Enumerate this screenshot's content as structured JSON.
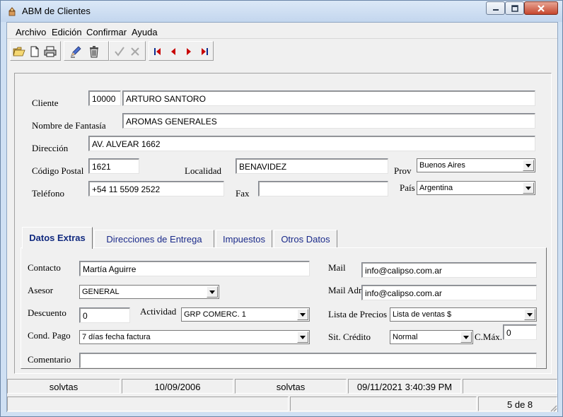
{
  "window": {
    "title": "ABM de Clientes"
  },
  "menu": {
    "items": [
      "Archivo",
      "Edición",
      "Confirmar",
      "Ayuda"
    ]
  },
  "toolbar": {
    "icons": [
      "open-folder-icon",
      "new-document-icon",
      "print-icon",
      "edit-pencil-icon",
      "delete-trash-icon",
      "confirm-check-icon",
      "cancel-x-icon",
      "first-record-icon",
      "previous-record-icon",
      "next-record-icon",
      "last-record-icon"
    ]
  },
  "form": {
    "cliente_label": "Cliente",
    "cliente_code": "10000",
    "cliente_name": "ARTURO SANTORO",
    "fantasia_label": "Nombre de Fantasía",
    "fantasia_value": "AROMAS GENERALES",
    "direccion_label": "Dirección",
    "direccion_value": "AV. ALVEAR 1662",
    "cp_label": "Código Postal",
    "cp_value": "1621",
    "localidad_label": "Localidad",
    "localidad_value": "BENAVIDEZ",
    "prov_label": "Prov",
    "prov_value": "Buenos Aires",
    "telefono_label": "Teléfono",
    "telefono_value": "+54 11 5509 2522",
    "fax_label": "Fax",
    "fax_value": "",
    "pais_label": "País",
    "pais_value": "Argentina"
  },
  "tabs": [
    {
      "label": "Datos Extras",
      "active": true
    },
    {
      "label": "Direcciones de Entrega",
      "active": false
    },
    {
      "label": "Impuestos",
      "active": false
    },
    {
      "label": "Otros Datos",
      "active": false
    }
  ],
  "extras": {
    "contacto_label": "Contacto",
    "contacto_value": "Martía Aguirre",
    "asesor_label": "Asesor",
    "asesor_value": "GENERAL",
    "descuento_label": "Descuento",
    "descuento_value": "0",
    "actividad_label": "Actividad",
    "actividad_value": "GRP COMERC. 1",
    "condpago_label": "Cond. Pago",
    "condpago_value": "7 días fecha factura",
    "comentario_label": "Comentario",
    "comentario_value": "",
    "mail_label": "Mail",
    "mail_value": "info@calipso.com.ar",
    "mailadm_label": "Mail Adm",
    "mailadm_value": "info@calipso.com.ar",
    "listaprecios_label": "Lista de Precios",
    "listaprecios_value": "Lista de ventas $",
    "sitcredito_label": "Sit. Crédito",
    "sitcredito_value": "Normal",
    "cmax_label": "C.Máx.",
    "cmax_value": "0"
  },
  "status": {
    "user": "solvtas",
    "date": "10/09/2006",
    "user2": "solvtas",
    "datetime": "09/11/2021 3:40:39 PM",
    "record": "5 de 8"
  },
  "colors": {
    "titlebar": "#c3d6ee",
    "close_button": "#c6472e",
    "tab_text": "#1a2a8a"
  }
}
